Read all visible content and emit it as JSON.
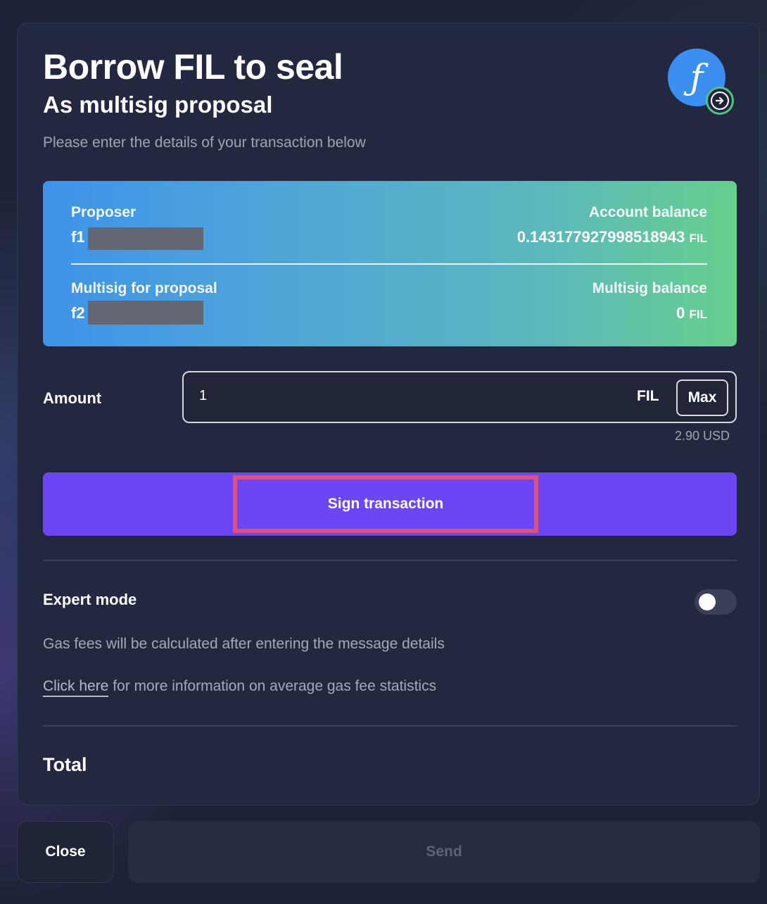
{
  "modal": {
    "title": "Borrow FIL to seal",
    "subtitle": "As multisig proposal",
    "instructions": "Please enter the details of your transaction below",
    "logo_glyph": "ƒ",
    "logo_icon": "filecoin-icon",
    "badge_icon": "arrow-right-icon"
  },
  "card": {
    "proposer_label": "Proposer",
    "proposer_value": "f1",
    "account_balance_label": "Account balance",
    "account_balance_value": "0.143177927998518943",
    "account_balance_unit": "FIL",
    "multisig_label": "Multisig for proposal",
    "multisig_value": "f2",
    "multisig_balance_label": "Multisig balance",
    "multisig_balance_value": "0",
    "multisig_balance_unit": "FIL",
    "gradient_colors": [
      "#3e93ea",
      "#66d08c"
    ]
  },
  "amount": {
    "label": "Amount",
    "value": "1",
    "unit": "FIL",
    "max_label": "Max",
    "usd_value": "2.90 USD"
  },
  "sign": {
    "label": "Sign transaction",
    "color": "#6c46f5",
    "highlight_color": "#e0517a"
  },
  "expert": {
    "label": "Expert mode",
    "enabled": false
  },
  "gas": {
    "note": "Gas fees will be calculated after entering the message details",
    "link_text": "Click here",
    "link_suffix": " for more information on average gas fee statistics"
  },
  "total": {
    "label": "Total"
  },
  "footer": {
    "close_label": "Close",
    "send_label": "Send"
  }
}
